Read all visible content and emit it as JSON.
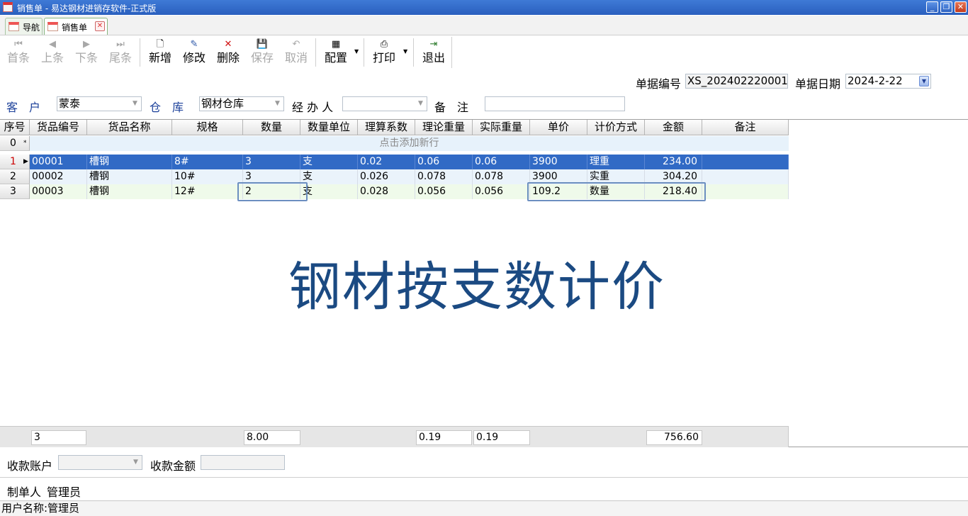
{
  "window": {
    "title": "销售单 - 易达钢材进销存软件-正式版",
    "minimize": "_",
    "restore": "❐",
    "close": "✕"
  },
  "tabs": [
    {
      "label": "导航"
    },
    {
      "label": "销售单",
      "close": "✕"
    }
  ],
  "toolbar": {
    "first": "首条",
    "prev": "上条",
    "next": "下条",
    "last": "尾条",
    "add": "新增",
    "edit": "修改",
    "delete": "删除",
    "save": "保存",
    "cancel": "取消",
    "config": "配置",
    "print": "打印",
    "exit": "退出",
    "icons": {
      "first": "⏮",
      "prev": "◀",
      "next": "▶",
      "last": "⏭",
      "add": "🗋",
      "edit": "✎",
      "delete": "✕",
      "save": "💾",
      "cancel": "↶",
      "config": "▦",
      "print": "⎙",
      "exit": "⇥"
    }
  },
  "header": {
    "doc_no_label": "单据编号",
    "doc_no": "XS_202402220001",
    "doc_date_label": "单据日期",
    "doc_date": "2024-2-22",
    "customer_label": "客　户",
    "customer": "蒙泰",
    "warehouse_label": "仓　库",
    "warehouse": "钢材仓库",
    "handler_label": "经 办 人",
    "handler": "",
    "remark_label": "备　注",
    "remark": ""
  },
  "grid": {
    "columns": [
      "序号",
      "货品编号",
      "货品名称",
      "规格",
      "数量",
      "数量单位",
      "理算系数",
      "理论重量",
      "实际重量",
      "单价",
      "计价方式",
      "金额",
      "备注"
    ],
    "new_row": {
      "num": "0",
      "marker": "*",
      "text": "点击添加新行"
    },
    "rows": [
      {
        "num": "1",
        "code": "00001",
        "name": "槽钢",
        "spec": "8#",
        "qty": "3",
        "unit": "支",
        "coef": "0.02",
        "theo": "0.06",
        "actual": "0.06",
        "price": "3900",
        "method": "理重",
        "amount": "234.00",
        "remark": ""
      },
      {
        "num": "2",
        "code": "00002",
        "name": "槽钢",
        "spec": "10#",
        "qty": "3",
        "unit": "支",
        "coef": "0.026",
        "theo": "0.078",
        "actual": "0.078",
        "price": "3900",
        "method": "实重",
        "amount": "304.20",
        "remark": ""
      },
      {
        "num": "3",
        "code": "00003",
        "name": "槽钢",
        "spec": "12#",
        "qty": "2",
        "unit": "支",
        "coef": "0.028",
        "theo": "0.056",
        "actual": "0.056",
        "price": "109.2",
        "method": "数量",
        "amount": "218.40",
        "remark": ""
      }
    ],
    "totals": {
      "count": "3",
      "qty": "8.00",
      "theo": "0.19",
      "actual": "0.19",
      "amount": "756.60"
    }
  },
  "banner": "钢材按支数计价",
  "bottom": {
    "account_label": "收款账户",
    "account": "",
    "amount_label": "收款金额",
    "amount": "",
    "maker_label": "制单人",
    "maker": "管理员"
  },
  "status": {
    "user": "用户名称:管理员"
  },
  "colors": {
    "title_bar": "#2a5fbe",
    "selected_row": "#316ac5",
    "banner": "#1b4a82",
    "label_blue": "#1a3f99"
  }
}
